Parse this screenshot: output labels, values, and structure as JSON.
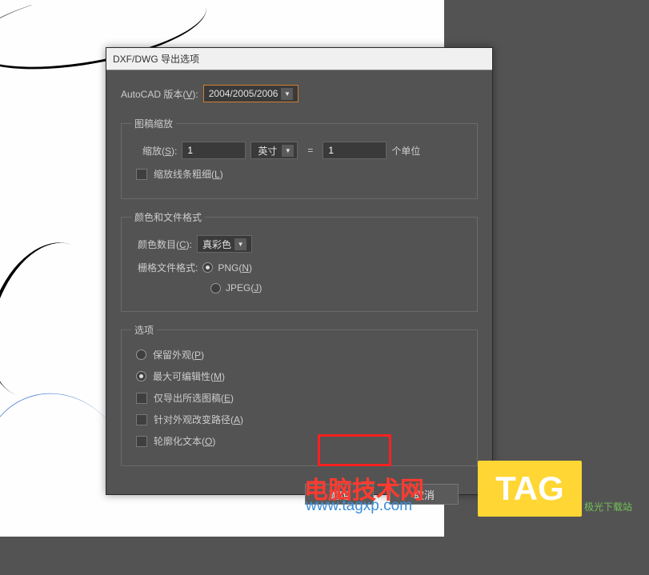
{
  "dialog": {
    "title": "DXF/DWG 导出选项",
    "version_label": "AutoCAD 版本(",
    "version_key": "V",
    "version_label2": "):",
    "version_value": "2004/2005/2006"
  },
  "scale": {
    "legend": "图稿缩放",
    "scale_label": "缩放(",
    "scale_key": "S",
    "scale_label2": "):",
    "scale_value": "1",
    "unit_value": "英寸",
    "equals": "=",
    "ratio_value": "1",
    "ratio_suffix": "个单位",
    "lineweight_label": "缩放线条粗细(",
    "lineweight_key": "L",
    "lineweight_label2": ")"
  },
  "color": {
    "legend": "颜色和文件格式",
    "colors_label": "颜色数目(",
    "colors_key": "C",
    "colors_label2": "):",
    "colors_value": "真彩色",
    "raster_label": "栅格文件格式:",
    "png_label": "PNG(",
    "png_key": "N",
    "png_label2": ")",
    "jpeg_label": "JPEG(",
    "jpeg_key": "J",
    "jpeg_label2": ")"
  },
  "options": {
    "legend": "选项",
    "preserve_label": "保留外观(",
    "preserve_key": "P",
    "preserve_label2": ")",
    "edit_label": "最大可编辑性(",
    "edit_key": "M",
    "edit_label2": ")",
    "selected_label": "仅导出所选图稿(",
    "selected_key": "E",
    "selected_label2": ")",
    "alter_label": "针对外观改变路径(",
    "alter_key": "A",
    "alter_label2": ")",
    "outline_label": "轮廓化文本(",
    "outline_key": "O",
    "outline_label2": ")"
  },
  "buttons": {
    "ok": "确定",
    "cancel": "取消"
  },
  "watermark": {
    "text1": "电脑技术网",
    "url1": "www.tagxp.com",
    "tag": "TAG",
    "sub": "极光下载站"
  }
}
